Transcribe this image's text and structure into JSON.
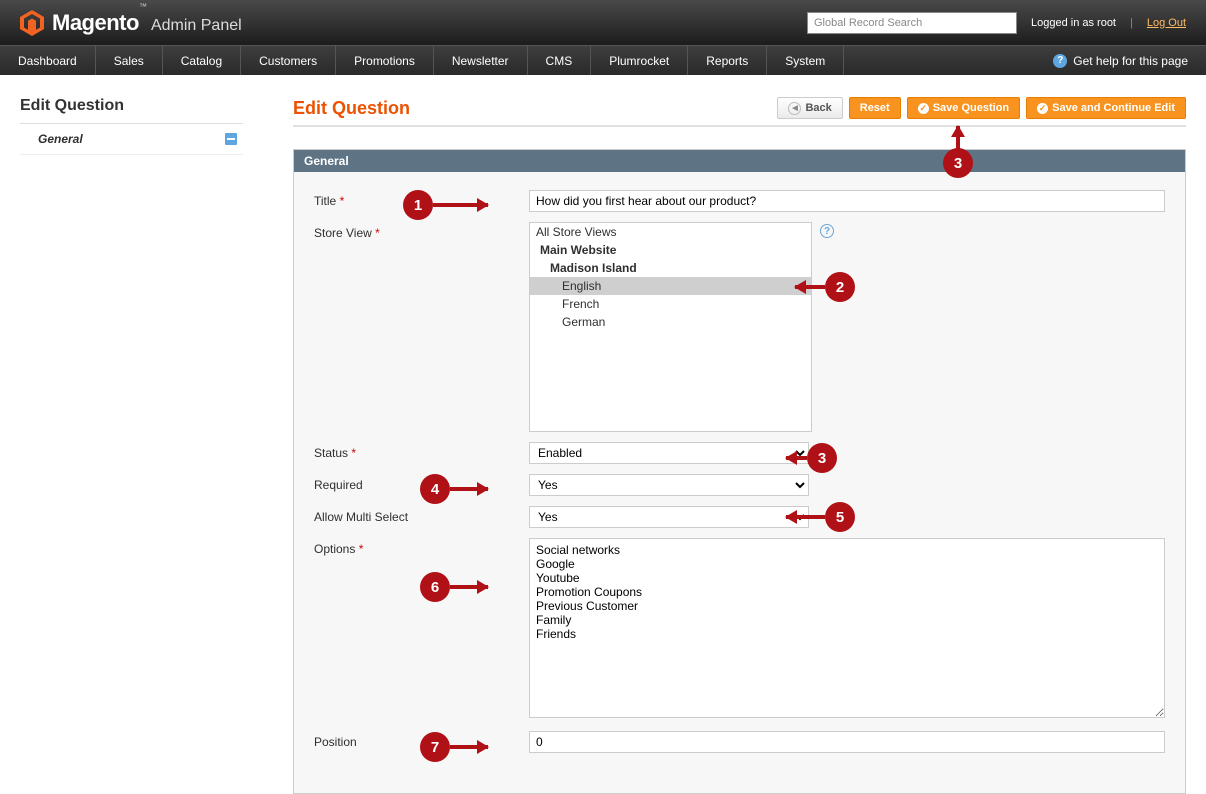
{
  "header": {
    "brand": "Magento",
    "brand_sub": "Admin Panel",
    "search_placeholder": "Global Record Search",
    "logged_in": "Logged in as root",
    "logout": "Log Out"
  },
  "nav": {
    "items": [
      "Dashboard",
      "Sales",
      "Catalog",
      "Customers",
      "Promotions",
      "Newsletter",
      "CMS",
      "Plumrocket",
      "Reports",
      "System"
    ],
    "help": "Get help for this page"
  },
  "sidebar": {
    "title": "Edit Question",
    "items": [
      {
        "label": "General"
      }
    ]
  },
  "page": {
    "title": "Edit Question",
    "back": "Back",
    "reset": "Reset",
    "save": "Save Question",
    "save_continue": "Save and Continue Edit"
  },
  "panel": {
    "title": "General"
  },
  "form": {
    "title_label": "Title",
    "title_value": "How did you first hear about our product?",
    "storeview_label": "Store View",
    "storeview": {
      "all": "All Store Views",
      "site": "Main Website",
      "group": "Madison Island",
      "stores": [
        "English",
        "French",
        "German"
      ],
      "selected": "English"
    },
    "status_label": "Status",
    "status_value": "Enabled",
    "required_label": "Required",
    "required_value": "Yes",
    "multiselect_label": "Allow Multi Select",
    "multiselect_value": "Yes",
    "options_label": "Options",
    "options_value": "Social networks\nGoogle\nYoutube\nPromotion Coupons\nPrevious Customer\nFamily\nFriends",
    "position_label": "Position",
    "position_value": "0"
  },
  "callouts": [
    "1",
    "2",
    "3",
    "3",
    "4",
    "5",
    "6",
    "7"
  ]
}
